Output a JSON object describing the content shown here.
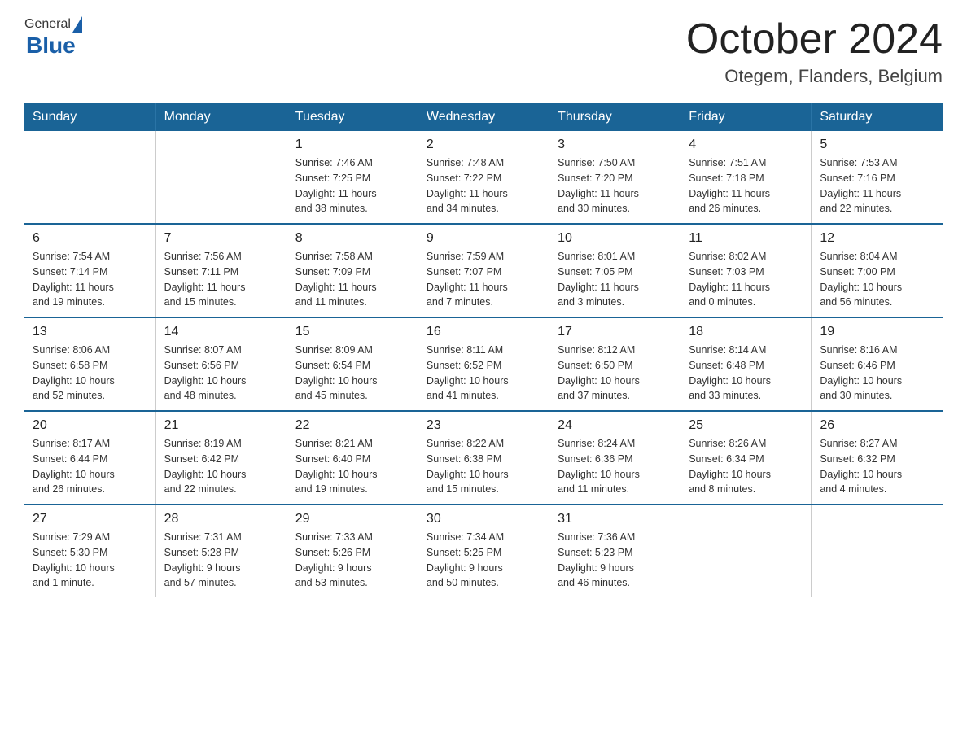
{
  "header": {
    "logo": {
      "general": "General",
      "blue": "Blue"
    },
    "title": "October 2024",
    "location": "Otegem, Flanders, Belgium"
  },
  "days_of_week": [
    "Sunday",
    "Monday",
    "Tuesday",
    "Wednesday",
    "Thursday",
    "Friday",
    "Saturday"
  ],
  "weeks": [
    [
      {
        "day": "",
        "info": ""
      },
      {
        "day": "",
        "info": ""
      },
      {
        "day": "1",
        "info": "Sunrise: 7:46 AM\nSunset: 7:25 PM\nDaylight: 11 hours\nand 38 minutes."
      },
      {
        "day": "2",
        "info": "Sunrise: 7:48 AM\nSunset: 7:22 PM\nDaylight: 11 hours\nand 34 minutes."
      },
      {
        "day": "3",
        "info": "Sunrise: 7:50 AM\nSunset: 7:20 PM\nDaylight: 11 hours\nand 30 minutes."
      },
      {
        "day": "4",
        "info": "Sunrise: 7:51 AM\nSunset: 7:18 PM\nDaylight: 11 hours\nand 26 minutes."
      },
      {
        "day": "5",
        "info": "Sunrise: 7:53 AM\nSunset: 7:16 PM\nDaylight: 11 hours\nand 22 minutes."
      }
    ],
    [
      {
        "day": "6",
        "info": "Sunrise: 7:54 AM\nSunset: 7:14 PM\nDaylight: 11 hours\nand 19 minutes."
      },
      {
        "day": "7",
        "info": "Sunrise: 7:56 AM\nSunset: 7:11 PM\nDaylight: 11 hours\nand 15 minutes."
      },
      {
        "day": "8",
        "info": "Sunrise: 7:58 AM\nSunset: 7:09 PM\nDaylight: 11 hours\nand 11 minutes."
      },
      {
        "day": "9",
        "info": "Sunrise: 7:59 AM\nSunset: 7:07 PM\nDaylight: 11 hours\nand 7 minutes."
      },
      {
        "day": "10",
        "info": "Sunrise: 8:01 AM\nSunset: 7:05 PM\nDaylight: 11 hours\nand 3 minutes."
      },
      {
        "day": "11",
        "info": "Sunrise: 8:02 AM\nSunset: 7:03 PM\nDaylight: 11 hours\nand 0 minutes."
      },
      {
        "day": "12",
        "info": "Sunrise: 8:04 AM\nSunset: 7:00 PM\nDaylight: 10 hours\nand 56 minutes."
      }
    ],
    [
      {
        "day": "13",
        "info": "Sunrise: 8:06 AM\nSunset: 6:58 PM\nDaylight: 10 hours\nand 52 minutes."
      },
      {
        "day": "14",
        "info": "Sunrise: 8:07 AM\nSunset: 6:56 PM\nDaylight: 10 hours\nand 48 minutes."
      },
      {
        "day": "15",
        "info": "Sunrise: 8:09 AM\nSunset: 6:54 PM\nDaylight: 10 hours\nand 45 minutes."
      },
      {
        "day": "16",
        "info": "Sunrise: 8:11 AM\nSunset: 6:52 PM\nDaylight: 10 hours\nand 41 minutes."
      },
      {
        "day": "17",
        "info": "Sunrise: 8:12 AM\nSunset: 6:50 PM\nDaylight: 10 hours\nand 37 minutes."
      },
      {
        "day": "18",
        "info": "Sunrise: 8:14 AM\nSunset: 6:48 PM\nDaylight: 10 hours\nand 33 minutes."
      },
      {
        "day": "19",
        "info": "Sunrise: 8:16 AM\nSunset: 6:46 PM\nDaylight: 10 hours\nand 30 minutes."
      }
    ],
    [
      {
        "day": "20",
        "info": "Sunrise: 8:17 AM\nSunset: 6:44 PM\nDaylight: 10 hours\nand 26 minutes."
      },
      {
        "day": "21",
        "info": "Sunrise: 8:19 AM\nSunset: 6:42 PM\nDaylight: 10 hours\nand 22 minutes."
      },
      {
        "day": "22",
        "info": "Sunrise: 8:21 AM\nSunset: 6:40 PM\nDaylight: 10 hours\nand 19 minutes."
      },
      {
        "day": "23",
        "info": "Sunrise: 8:22 AM\nSunset: 6:38 PM\nDaylight: 10 hours\nand 15 minutes."
      },
      {
        "day": "24",
        "info": "Sunrise: 8:24 AM\nSunset: 6:36 PM\nDaylight: 10 hours\nand 11 minutes."
      },
      {
        "day": "25",
        "info": "Sunrise: 8:26 AM\nSunset: 6:34 PM\nDaylight: 10 hours\nand 8 minutes."
      },
      {
        "day": "26",
        "info": "Sunrise: 8:27 AM\nSunset: 6:32 PM\nDaylight: 10 hours\nand 4 minutes."
      }
    ],
    [
      {
        "day": "27",
        "info": "Sunrise: 7:29 AM\nSunset: 5:30 PM\nDaylight: 10 hours\nand 1 minute."
      },
      {
        "day": "28",
        "info": "Sunrise: 7:31 AM\nSunset: 5:28 PM\nDaylight: 9 hours\nand 57 minutes."
      },
      {
        "day": "29",
        "info": "Sunrise: 7:33 AM\nSunset: 5:26 PM\nDaylight: 9 hours\nand 53 minutes."
      },
      {
        "day": "30",
        "info": "Sunrise: 7:34 AM\nSunset: 5:25 PM\nDaylight: 9 hours\nand 50 minutes."
      },
      {
        "day": "31",
        "info": "Sunrise: 7:36 AM\nSunset: 5:23 PM\nDaylight: 9 hours\nand 46 minutes."
      },
      {
        "day": "",
        "info": ""
      },
      {
        "day": "",
        "info": ""
      }
    ]
  ]
}
